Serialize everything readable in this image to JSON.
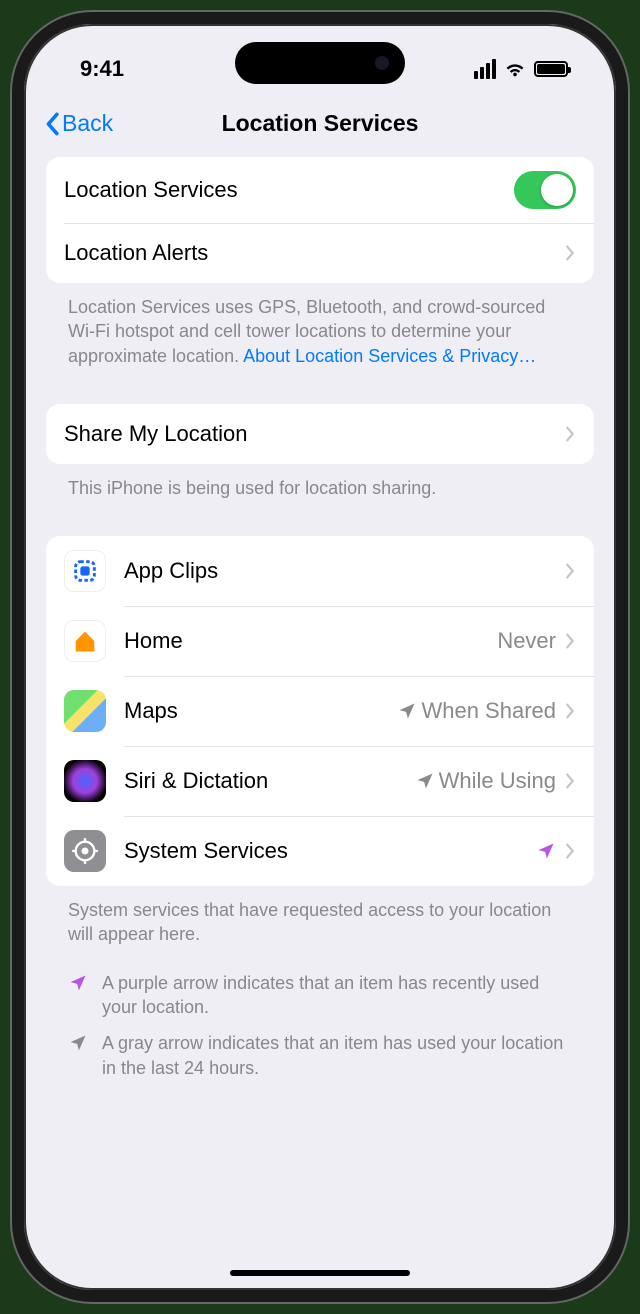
{
  "status": {
    "time": "9:41"
  },
  "nav": {
    "back": "Back",
    "title": "Location Services"
  },
  "section1": {
    "location_services": "Location Services",
    "location_alerts": "Location Alerts",
    "footer_plain": "Location Services uses GPS, Bluetooth, and crowd-sourced Wi-Fi hotspot and cell tower locations to determine your approximate location. ",
    "footer_link": "About Location Services & Privacy…"
  },
  "section2": {
    "share": "Share My Location",
    "footer": "This iPhone is being used for location sharing."
  },
  "apps": [
    {
      "name": "App Clips",
      "value": "",
      "arrow": ""
    },
    {
      "name": "Home",
      "value": "Never",
      "arrow": ""
    },
    {
      "name": "Maps",
      "value": "When Shared",
      "arrow": "gray"
    },
    {
      "name": "Siri & Dictation",
      "value": "While Using",
      "arrow": "gray"
    },
    {
      "name": "System Services",
      "value": "",
      "arrow": "purple"
    }
  ],
  "apps_footer": "System services that have requested access to your location will appear here.",
  "legend": {
    "purple": "A purple arrow indicates that an item has recently used your location.",
    "gray": "A gray arrow indicates that an item has used your location in the last 24 hours."
  }
}
